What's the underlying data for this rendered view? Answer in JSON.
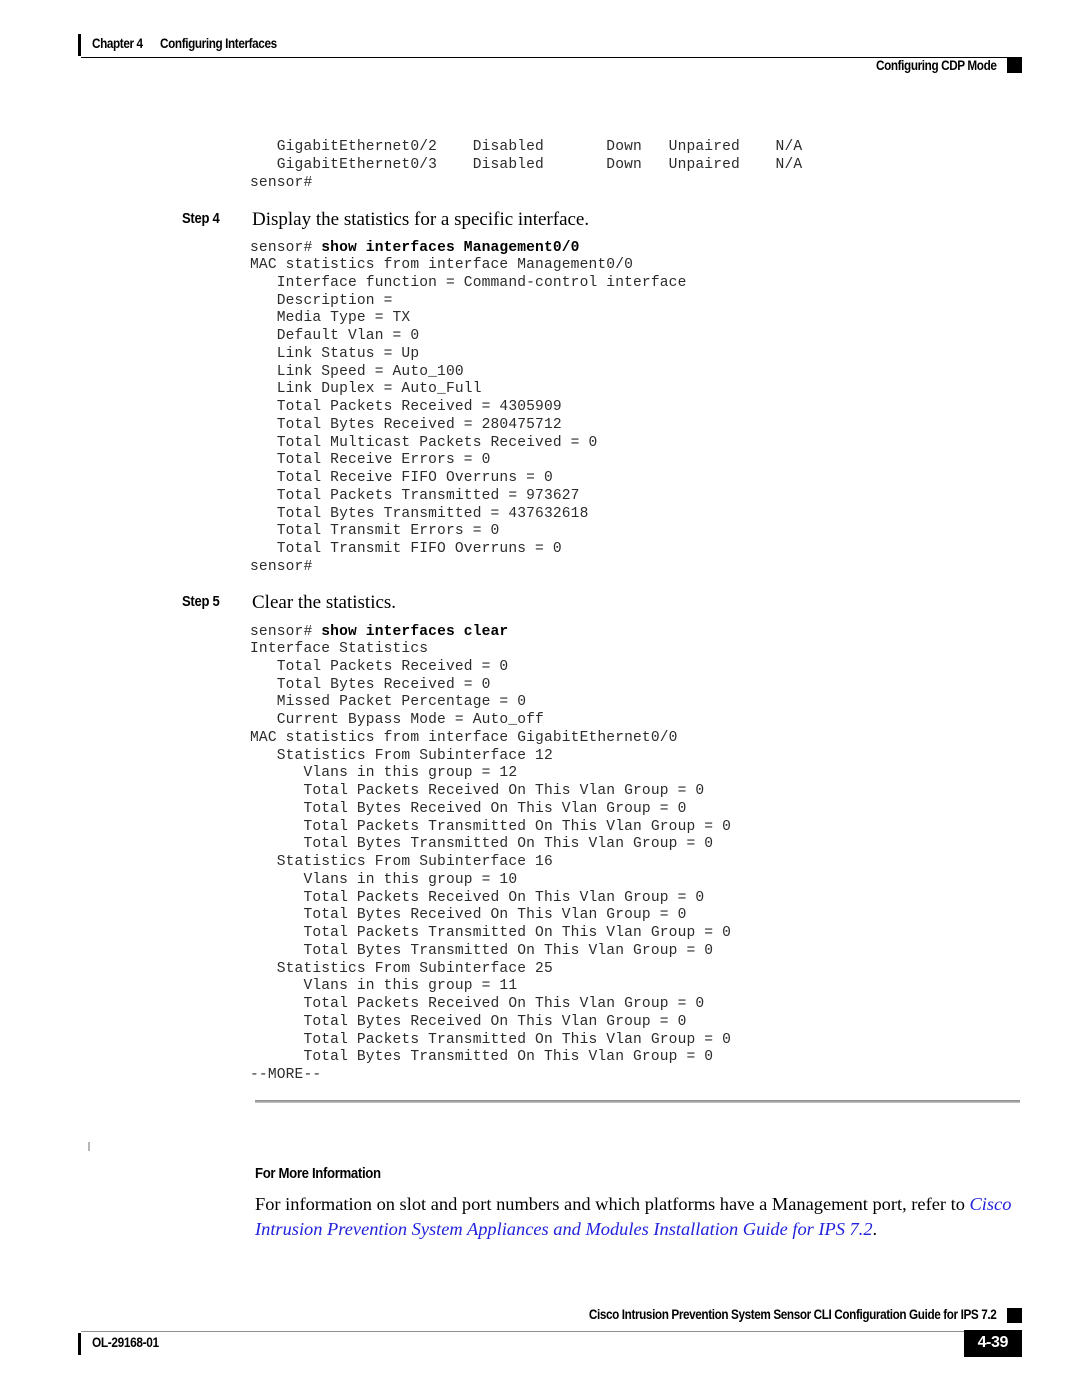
{
  "header": {
    "chapter_number": "Chapter 4",
    "chapter_title": "Configuring Interfaces",
    "running_head_right": "Configuring CDP Mode"
  },
  "footer": {
    "doc_id": "OL-29168-01",
    "guide_title": "Cisco Intrusion Prevention System Sensor CLI Configuration Guide for IPS 7.2",
    "page_number": "4-39"
  },
  "cli_top": "   GigabitEthernet0/2    Disabled       Down   Unpaired    N/A\n   GigabitEthernet0/3    Disabled       Down   Unpaired    N/A\nsensor#",
  "steps": [
    {
      "label": "Step 4",
      "text": "Display the statistics for a specific interface.",
      "command_prompt": "sensor# ",
      "command": "show interfaces Management0/0",
      "output": "MAC statistics from interface Management0/0\n   Interface function = Command-control interface\n   Description = \n   Media Type = TX\n   Default Vlan = 0\n   Link Status = Up\n   Link Speed = Auto_100\n   Link Duplex = Auto_Full\n   Total Packets Received = 4305909\n   Total Bytes Received = 280475712\n   Total Multicast Packets Received = 0\n   Total Receive Errors = 0\n   Total Receive FIFO Overruns = 0\n   Total Packets Transmitted = 973627\n   Total Bytes Transmitted = 437632618\n   Total Transmit Errors = 0\n   Total Transmit FIFO Overruns = 0\nsensor#"
    },
    {
      "label": "Step 5",
      "text": "Clear the statistics.",
      "command_prompt": "sensor# ",
      "command": "show interfaces clear",
      "output": "Interface Statistics\n   Total Packets Received = 0\n   Total Bytes Received = 0\n   Missed Packet Percentage = 0\n   Current Bypass Mode = Auto_off\nMAC statistics from interface GigabitEthernet0/0\n   Statistics From Subinterface 12\n      Vlans in this group = 12\n      Total Packets Received On This Vlan Group = 0\n      Total Bytes Received On This Vlan Group = 0\n      Total Packets Transmitted On This Vlan Group = 0\n      Total Bytes Transmitted On This Vlan Group = 0\n   Statistics From Subinterface 16\n      Vlans in this group = 10\n      Total Packets Received On This Vlan Group = 0\n      Total Bytes Received On This Vlan Group = 0\n      Total Packets Transmitted On This Vlan Group = 0\n      Total Bytes Transmitted On This Vlan Group = 0\n   Statistics From Subinterface 25\n      Vlans in this group = 11\n      Total Packets Received On This Vlan Group = 0\n      Total Bytes Received On This Vlan Group = 0\n      Total Packets Transmitted On This Vlan Group = 0\n      Total Bytes Transmitted On This Vlan Group = 0\n--MORE--"
    }
  ],
  "for_more_information": {
    "heading": "For More Information",
    "text_before_link": "For information on slot and port numbers and which platforms have a Management port, refer to ",
    "link_text": "Cisco Intrusion Prevention System Appliances and Modules Installation Guide for IPS 7.2",
    "text_after_link": ".",
    "link_color": "#2222dd"
  }
}
